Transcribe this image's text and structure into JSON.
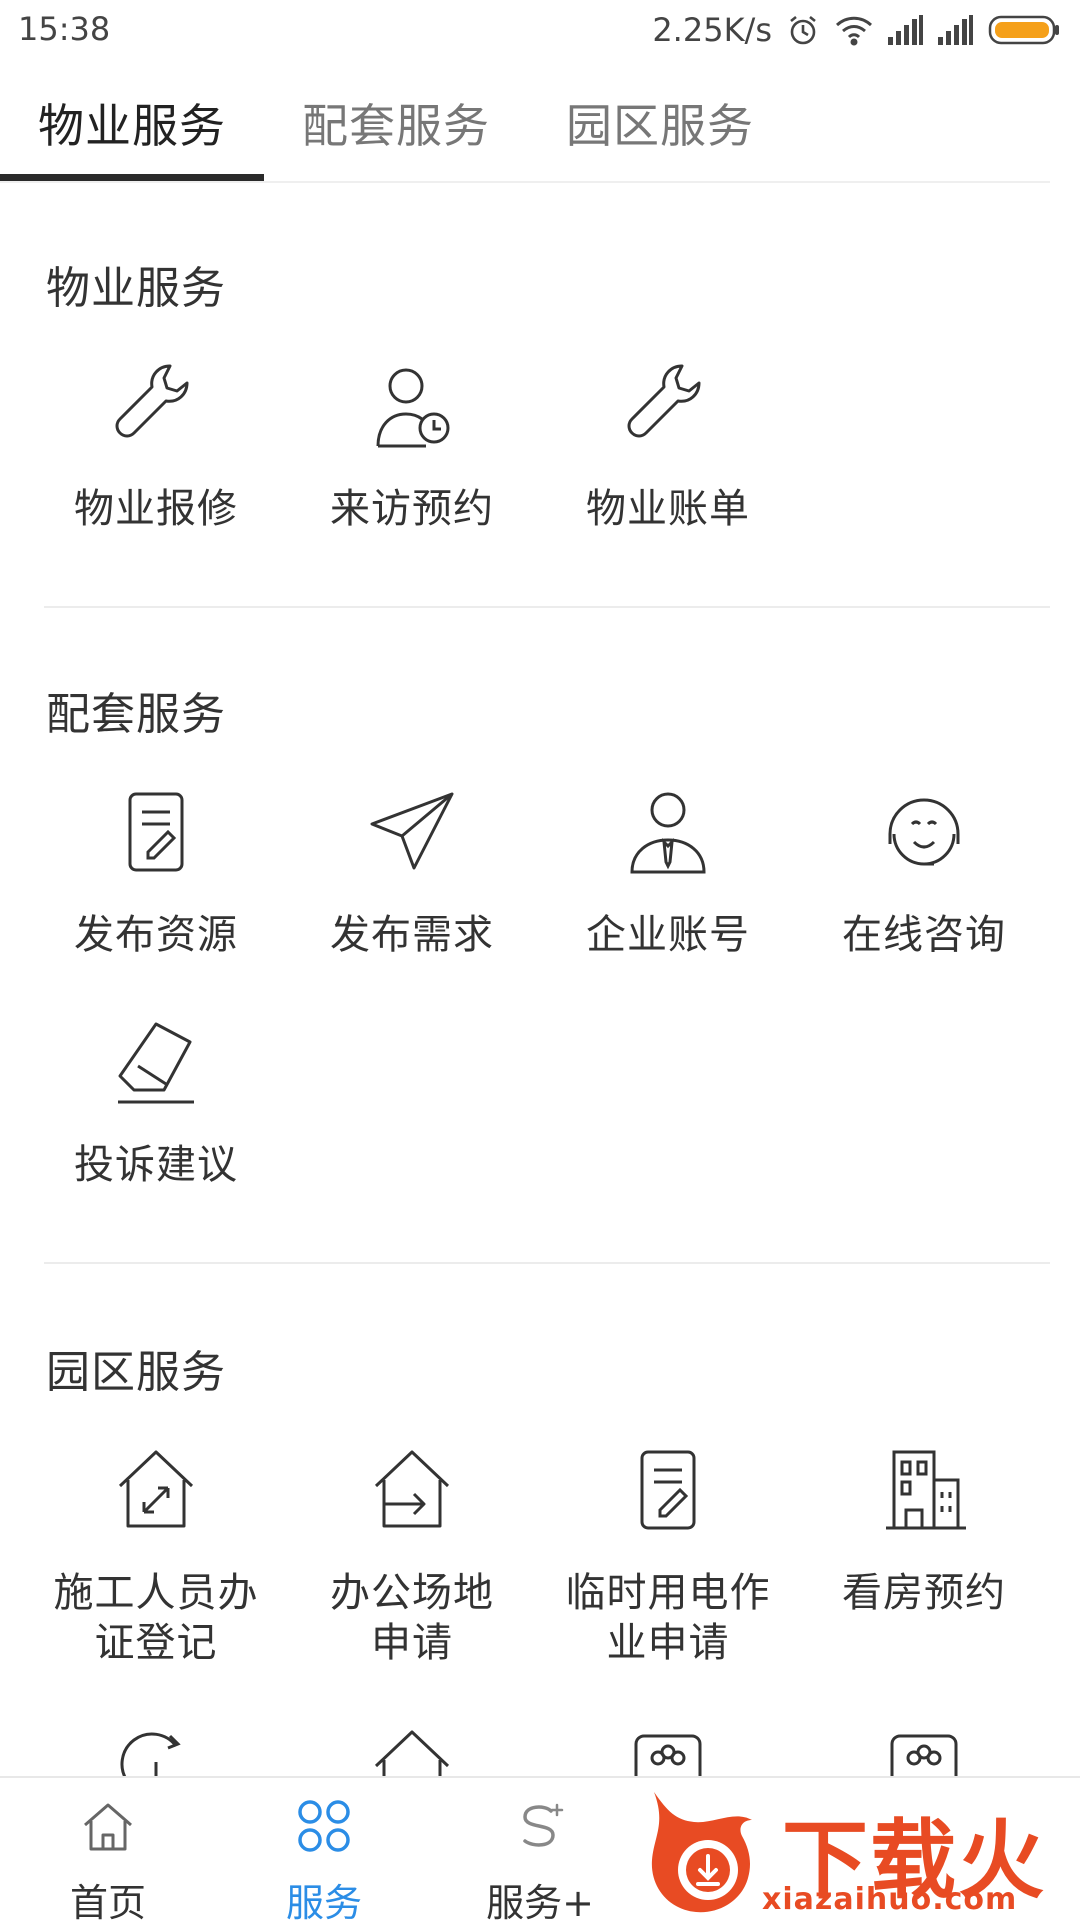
{
  "status_bar": {
    "time": "15:38",
    "net_speed": "2.25K/s",
    "icons": [
      "alarm-icon",
      "wifi-icon",
      "signal-icon",
      "signal-icon",
      "battery-icon"
    ]
  },
  "tabs": [
    {
      "label": "物业服务",
      "active": true
    },
    {
      "label": "配套服务",
      "active": false
    },
    {
      "label": "园区服务",
      "active": false
    }
  ],
  "sections": {
    "property": {
      "title": "物业服务",
      "items": [
        {
          "label": "物业报修",
          "icon": "wrench-icon"
        },
        {
          "label": "来访预约",
          "icon": "visitor-clock-icon"
        },
        {
          "label": "物业账单",
          "icon": "wrench-icon"
        }
      ]
    },
    "support": {
      "title": "配套服务",
      "items": [
        {
          "label": "发布资源",
          "icon": "document-edit-icon"
        },
        {
          "label": "发布需求",
          "icon": "paper-plane-icon"
        },
        {
          "label": "企业账号",
          "icon": "business-person-icon"
        },
        {
          "label": "在线咨询",
          "icon": "headset-smile-icon"
        },
        {
          "label": "投诉建议",
          "icon": "eraser-icon"
        }
      ]
    },
    "park": {
      "title": "园区服务",
      "items": [
        {
          "label": "施工人员办证登记",
          "line1": "施工人员办",
          "line2": "证登记",
          "icon": "house-expand-icon"
        },
        {
          "label": "办公场地申请",
          "line1": "办公场地",
          "line2": "申请",
          "icon": "house-arrow-icon"
        },
        {
          "label": "临时用电作业申请",
          "line1": "临时用电作",
          "line2": "业申请",
          "icon": "document-edit-icon"
        },
        {
          "label": "看房预约",
          "line1": "看房预约",
          "line2": "",
          "icon": "building-icon"
        }
      ]
    }
  },
  "bottom_nav": [
    {
      "label": "首页",
      "icon": "home-icon",
      "active": false
    },
    {
      "label": "服务",
      "icon": "grid-petals-icon",
      "active": true
    },
    {
      "label": "服务+",
      "icon": "service-plus-icon",
      "active": false
    }
  ],
  "watermark": {
    "brand": "下载火",
    "url": "xiazaihuo.com"
  },
  "colors": {
    "active_nav": "#2b8de6",
    "watermark": "#e84b23"
  }
}
